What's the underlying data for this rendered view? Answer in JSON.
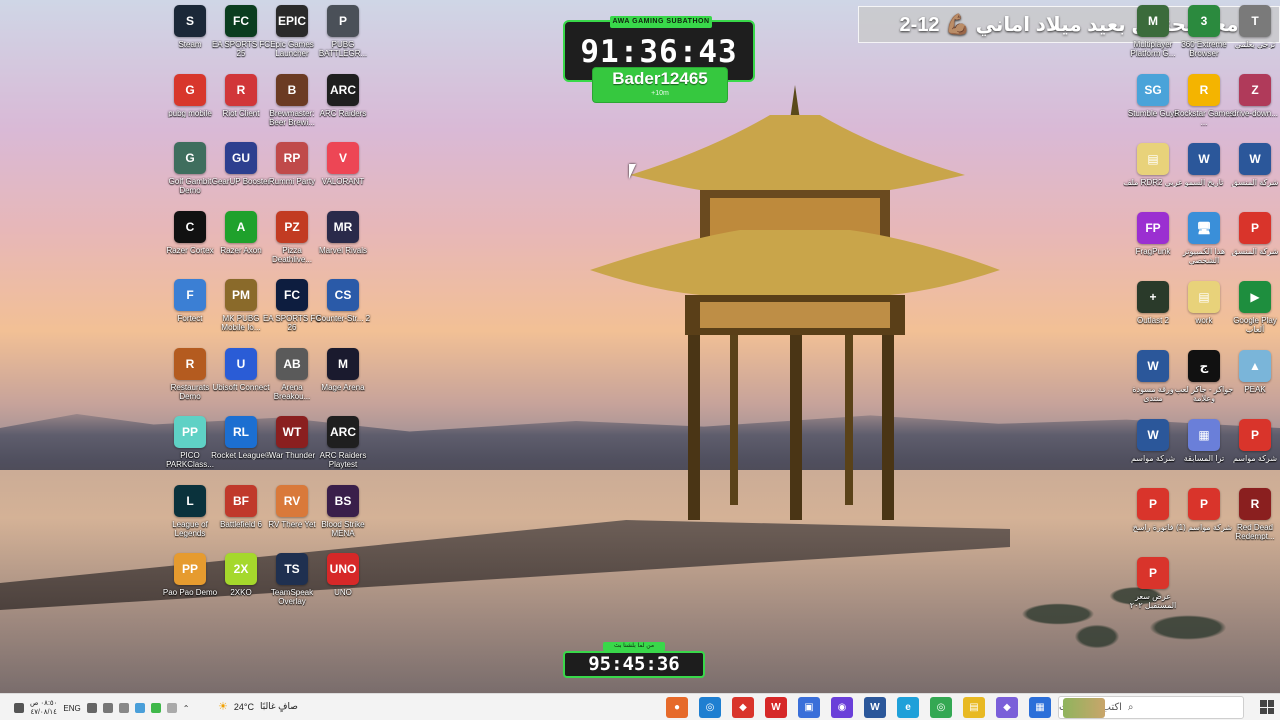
{
  "banner": {
    "text": "معاً لنحتفل بعيد ميلاد اماني 💪🏽 12-2"
  },
  "subathon": {
    "title": "AWA GAMING SUBATHON",
    "time": "91:36:43",
    "name": "Bader12465",
    "tag": "+10m"
  },
  "bottom_timer": {
    "title": "من لما بلشنا بث",
    "time": "95:45:36"
  },
  "left_icons": [
    {
      "label": "Steam",
      "icon": "steam-icon",
      "color": "#1b2838",
      "glyph": "S"
    },
    {
      "label": "EA SPORTS FC 25",
      "icon": "fc25-icon",
      "color": "#0b3d1f",
      "glyph": "FC"
    },
    {
      "label": "Epic Games Launcher",
      "icon": "epic-icon",
      "color": "#2a2a2a",
      "glyph": "EPIC"
    },
    {
      "label": "PUBG BATTLEGR...",
      "icon": "pubg-icon",
      "color": "#4a5058",
      "glyph": "P"
    },
    {
      "label": "pubg mobile",
      "icon": "pubgm-icon",
      "color": "#d8372c",
      "glyph": "G"
    },
    {
      "label": "Riot Client",
      "icon": "riot-icon",
      "color": "#d13639",
      "glyph": "R"
    },
    {
      "label": "Brewmaster: Beer Brewi...",
      "icon": "brew-icon",
      "color": "#6b3b23",
      "glyph": "B"
    },
    {
      "label": "ARC Raiders",
      "icon": "arc-icon",
      "color": "#1f1f1f",
      "glyph": "ARC"
    },
    {
      "label": "Golf Gambit Demo",
      "icon": "golf-icon",
      "color": "#3f6e5e",
      "glyph": "G"
    },
    {
      "label": "GearUP Booster",
      "icon": "gearup-icon",
      "color": "#2d3f8f",
      "glyph": "GU"
    },
    {
      "label": "Rummi Party",
      "icon": "rummi-icon",
      "color": "#c04a4a",
      "glyph": "RP"
    },
    {
      "label": "VALORANT",
      "icon": "valorant-icon",
      "color": "#ed4655",
      "glyph": "V"
    },
    {
      "label": "Razer Cortex",
      "icon": "cortex-icon",
      "color": "#111",
      "glyph": "C"
    },
    {
      "label": "Razer Axon",
      "icon": "axon-icon",
      "color": "#1fa12c",
      "glyph": "A"
    },
    {
      "label": "Pizza Deathlive...",
      "icon": "pizza-icon",
      "color": "#c23b22",
      "glyph": "PZ"
    },
    {
      "label": "Marvel Rivals",
      "icon": "marvel-icon",
      "color": "#2a2a4a",
      "glyph": "MR"
    },
    {
      "label": "Fortect",
      "icon": "fortect-icon",
      "color": "#3b7fd4",
      "glyph": "F"
    },
    {
      "label": "MK PUBG Mobile Io...",
      "icon": "mkpubg-icon",
      "color": "#8a6a2a",
      "glyph": "PM"
    },
    {
      "label": "EA SPORTS FC 26",
      "icon": "fc26-icon",
      "color": "#0d1d3f",
      "glyph": "FC"
    },
    {
      "label": "Counter-Str... 2",
      "icon": "cs2-icon",
      "color": "#2a5aa8",
      "glyph": "CS"
    },
    {
      "label": "Restaurats Demo",
      "icon": "restaurats-icon",
      "color": "#b45b1f",
      "glyph": "R"
    },
    {
      "label": "Ubisoft Connect",
      "icon": "ubisoft-icon",
      "color": "#2a5cd6",
      "glyph": "U"
    },
    {
      "label": "Arena Breakou...",
      "icon": "arena-icon",
      "color": "#5a5a5a",
      "glyph": "AB"
    },
    {
      "label": "Mage Arena",
      "icon": "mage-icon",
      "color": "#1a1a2e",
      "glyph": "M"
    },
    {
      "label": "PICO PARKClass...",
      "icon": "pico-icon",
      "color": "#5fd1c5",
      "glyph": "PP"
    },
    {
      "label": "Rocket League®",
      "icon": "rocket-icon",
      "color": "#1c6fd1",
      "glyph": "RL"
    },
    {
      "label": "War Thunder",
      "icon": "warthunder-icon",
      "color": "#8a1f1f",
      "glyph": "WT"
    },
    {
      "label": "ARC Raiders Playtest",
      "icon": "arcplay-icon",
      "color": "#1f1f1f",
      "glyph": "ARC"
    },
    {
      "label": "League of Legends",
      "icon": "lol-icon",
      "color": "#0a323c",
      "glyph": "L"
    },
    {
      "label": "Battlefield 6",
      "icon": "bf6-icon",
      "color": "#c0392b",
      "glyph": "BF"
    },
    {
      "label": "RV There Yet",
      "icon": "rv-icon",
      "color": "#d9793a",
      "glyph": "RV"
    },
    {
      "label": "Blood Strike MENA",
      "icon": "bloodstrike-icon",
      "color": "#3a1f4a",
      "glyph": "BS"
    },
    {
      "label": "Pao Pao Demo",
      "icon": "paopao-icon",
      "color": "#e69b2f",
      "glyph": "PP"
    },
    {
      "label": "2XKO",
      "icon": "2xko-icon",
      "color": "#a5d82c",
      "glyph": "2X"
    },
    {
      "label": "TeamSpeak Overlay",
      "icon": "teamspeak-icon",
      "color": "#1f3050",
      "glyph": "TS"
    },
    {
      "label": "UNO",
      "icon": "uno-icon",
      "color": "#d62828",
      "glyph": "UNO"
    }
  ],
  "right_icons": [
    {
      "label": "Multiplayer Platform G...",
      "icon": "multiplayer-icon",
      "color": "#3b6b3b",
      "glyph": "M"
    },
    {
      "label": "360 Extreme Browser",
      "icon": "browser360-icon",
      "color": "#2b8a3e",
      "glyph": "3"
    },
    {
      "label": "ترجي يعلمي",
      "icon": "app-icon",
      "color": "#7a7a7a",
      "glyph": "T"
    },
    {
      "label": "Stumble Guys",
      "icon": "stumble-icon",
      "color": "#4aa3d9",
      "glyph": "SG"
    },
    {
      "label": "Rockstar Games ...",
      "icon": "rockstar-icon",
      "color": "#f4b400",
      "glyph": "R"
    },
    {
      "label": "drive-down...",
      "icon": "archive-icon",
      "color": "#b03a5a",
      "glyph": "Z"
    },
    {
      "label": "ملف RDR2 عربي",
      "icon": "folder-icon",
      "color": "#e8d27a",
      "glyph": "▤"
    },
    {
      "label": "تاريخ السمو",
      "icon": "word-icon",
      "color": "#2b579a",
      "glyph": "W"
    },
    {
      "label": "شركة المنسق",
      "icon": "word-icon",
      "color": "#2b579a",
      "glyph": "W"
    },
    {
      "label": "FragPunk",
      "icon": "fragpunk-icon",
      "color": "#9b2fd1",
      "glyph": "FP"
    },
    {
      "label": "هذا الكمبيوتر الشخصي",
      "icon": "pc-icon",
      "color": "#3a8fd9",
      "glyph": "🖥"
    },
    {
      "label": "شركة المنسق",
      "icon": "pdf-icon",
      "color": "#d9342b",
      "glyph": "P"
    },
    {
      "label": "Outlast 2",
      "icon": "outlast-icon",
      "color": "#2a3a2a",
      "glyph": "+"
    },
    {
      "label": "work",
      "icon": "folder-icon",
      "color": "#e8d27a",
      "glyph": "▤"
    },
    {
      "label": "Google Play ألعاب",
      "icon": "googleplay-icon",
      "color": "#1e8e3e",
      "glyph": "▶"
    },
    {
      "label": "ورقة مسودة منتدى",
      "icon": "word-icon",
      "color": "#2b579a",
      "glyph": "W"
    },
    {
      "label": "جواكر - جاكر لعب وعلامة",
      "icon": "jawaker-icon",
      "color": "#111",
      "glyph": "ج"
    },
    {
      "label": "PEAK",
      "icon": "peak-icon",
      "color": "#7ab5d9",
      "glyph": "▲"
    },
    {
      "label": "شركة مواسم",
      "icon": "word-icon",
      "color": "#2b579a",
      "glyph": "W"
    },
    {
      "label": "ترا المسابقة",
      "icon": "image-icon",
      "color": "#6a7fd9",
      "glyph": "▦"
    },
    {
      "label": "شركة مواسم",
      "icon": "pdf-icon",
      "color": "#d9342b",
      "glyph": "P"
    },
    {
      "label": "فاتورة راسخ",
      "icon": "pdf-icon",
      "color": "#d9342b",
      "glyph": "P"
    },
    {
      "label": "شركة مواسم (1)",
      "icon": "pdf-icon",
      "color": "#d9342b",
      "glyph": "P"
    },
    {
      "label": "Red Dead Redempt...",
      "icon": "rdr-icon",
      "color": "#8a1f1f",
      "glyph": "R"
    },
    {
      "label": "عرض سعر المستقبل ٢٠٢",
      "icon": "pdf-icon",
      "color": "#d9342b",
      "glyph": "P"
    }
  ],
  "taskbar": {
    "search_placeholder": "اكتب هنا للبحث",
    "weather_temp": "24°C",
    "weather_text": "صافٍ غالبًا",
    "lang": "ENG",
    "clock_time": "٠٨:٥٠ ص",
    "clock_date": "٤٧/٠٨/١٤",
    "apps": [
      {
        "name": "taskbar-app-1",
        "color": "#e66a2a",
        "glyph": "●"
      },
      {
        "name": "taskbar-app-2",
        "color": "#1f7fd1",
        "glyph": "◎"
      },
      {
        "name": "taskbar-app-3",
        "color": "#d9342b",
        "glyph": "◆"
      },
      {
        "name": "taskbar-app-4",
        "color": "#d62828",
        "glyph": "W"
      },
      {
        "name": "taskbar-app-5",
        "color": "#3a6fd9",
        "glyph": "▣"
      },
      {
        "name": "taskbar-app-6",
        "color": "#6a3fd9",
        "glyph": "◉"
      },
      {
        "name": "taskbar-app-7",
        "color": "#2b579a",
        "glyph": "W"
      },
      {
        "name": "taskbar-app-edge",
        "color": "#1fa0d9",
        "glyph": "e"
      },
      {
        "name": "taskbar-app-chrome",
        "color": "#34a853",
        "glyph": "◎"
      },
      {
        "name": "taskbar-app-explorer",
        "color": "#e8b923",
        "glyph": "▤"
      },
      {
        "name": "taskbar-app-11",
        "color": "#7a5fd9",
        "glyph": "◆"
      },
      {
        "name": "taskbar-app-store",
        "color": "#2b6fd9",
        "glyph": "▦"
      }
    ]
  }
}
